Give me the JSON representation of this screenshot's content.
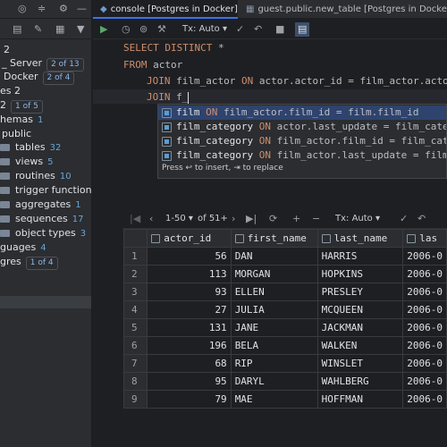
{
  "sidebar": {
    "rows": [
      {
        "label": "2",
        "badge": ""
      },
      {
        "label": "_ Server",
        "badge": "2 of 13"
      },
      {
        "label": "Docker",
        "badge": "2 of 4"
      },
      {
        "label": "es 2",
        "badge": ""
      },
      {
        "label": "2",
        "badge": "1 of 5"
      },
      {
        "label": "hemas",
        "count": "1"
      },
      {
        "label": "public",
        "count": ""
      }
    ],
    "folders": [
      {
        "label": "tables",
        "count": "32"
      },
      {
        "label": "views",
        "count": "5"
      },
      {
        "label": "routines",
        "count": "10"
      },
      {
        "label": "trigger functions",
        "count": ""
      },
      {
        "label": "aggregates",
        "count": "1"
      },
      {
        "label": "sequences",
        "count": "17"
      },
      {
        "label": "object types",
        "count": "3"
      }
    ],
    "after": [
      {
        "label": "guages",
        "count": "4"
      },
      {
        "label": "gres",
        "badge": "1 of 4"
      }
    ]
  },
  "tabs": [
    {
      "label": "console [Postgres in Docker]",
      "active": true
    },
    {
      "label": "guest.public.new_table [Postgres in Docker]",
      "active": false
    }
  ],
  "editor_toolbar": {
    "tx_mode": "Tx: Auto"
  },
  "editor": {
    "lines": [
      {
        "kw1": "SELECT DISTINCT",
        "rest": " *"
      },
      {
        "kw1": "FROM",
        "rest": " actor"
      },
      {
        "kw1": "JOIN",
        "rest": " film_actor ",
        "kw2": "ON",
        "rest2": " actor.actor_id = film_actor.actor_"
      },
      {
        "kw1": "JOIN",
        "rest": " f_"
      }
    ]
  },
  "completion": {
    "items": [
      {
        "table": "film",
        "on": "ON",
        "cond": "film_actor.film_id = film.film_id",
        "selected": true
      },
      {
        "table": "film_category",
        "on": "ON",
        "cond": "actor.last_update = film_category",
        "selected": false
      },
      {
        "table": "film_category",
        "on": "ON",
        "cond": "film_actor.film_id = film_catego",
        "selected": false
      },
      {
        "table": "film_category",
        "on": "ON",
        "cond": "film_actor.last_update = film_cat",
        "selected": false
      }
    ],
    "hint": "Press ↩ to insert, ⇥ to replace"
  },
  "results_toolbar": {
    "page_range": "1-50",
    "of_label": "of 51+",
    "tx_mode": "Tx: Auto"
  },
  "grid": {
    "columns": [
      "actor_id",
      "first_name",
      "last_name",
      "las"
    ],
    "rows": [
      {
        "n": "1",
        "actor_id": "56",
        "first_name": "DAN",
        "last_name": "HARRIS",
        "last": "2006-0"
      },
      {
        "n": "2",
        "actor_id": "113",
        "first_name": "MORGAN",
        "last_name": "HOPKINS",
        "last": "2006-0"
      },
      {
        "n": "3",
        "actor_id": "93",
        "first_name": "ELLEN",
        "last_name": "PRESLEY",
        "last": "2006-0"
      },
      {
        "n": "4",
        "actor_id": "27",
        "first_name": "JULIA",
        "last_name": "MCQUEEN",
        "last": "2006-0"
      },
      {
        "n": "5",
        "actor_id": "131",
        "first_name": "JANE",
        "last_name": "JACKMAN",
        "last": "2006-0"
      },
      {
        "n": "6",
        "actor_id": "196",
        "first_name": "BELA",
        "last_name": "WALKEN",
        "last": "2006-0"
      },
      {
        "n": "7",
        "actor_id": "68",
        "first_name": "RIP",
        "last_name": "WINSLET",
        "last": "2006-0"
      },
      {
        "n": "8",
        "actor_id": "95",
        "first_name": "DARYL",
        "last_name": "WAHLBERG",
        "last": "2006-0"
      },
      {
        "n": "9",
        "actor_id": "79",
        "first_name": "MAE",
        "last_name": "HOFFMAN",
        "last": "2006-0"
      }
    ]
  },
  "colors": {
    "accent": "#3574f0",
    "keyword": "#cf8e6d",
    "selection": "#2e436e"
  }
}
